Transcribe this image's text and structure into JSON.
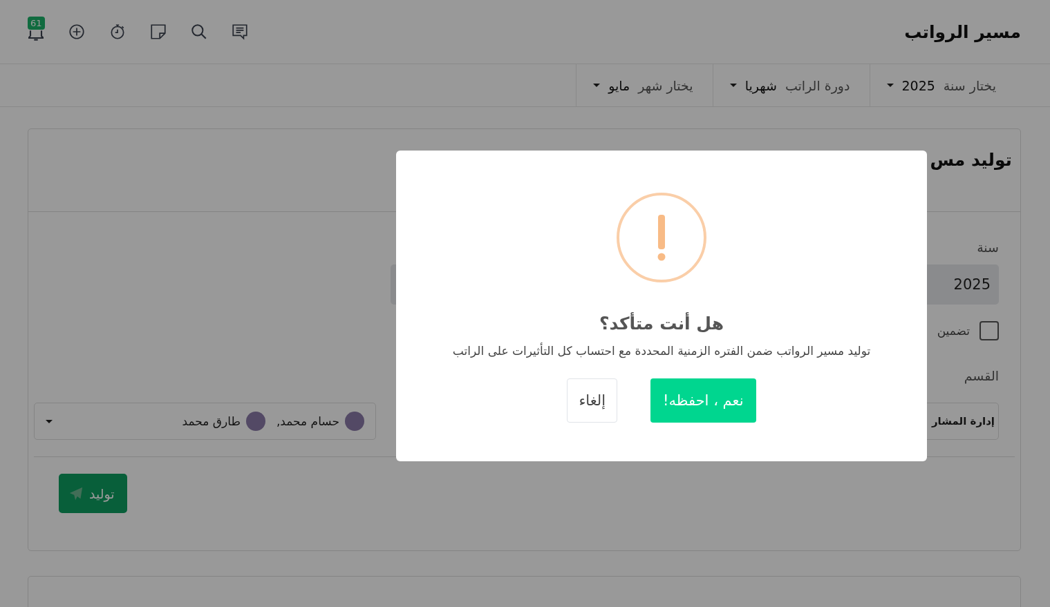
{
  "header": {
    "title": "مسير الرواتب",
    "notification_count": "61"
  },
  "filters": [
    {
      "label": "يختار سنة",
      "value": "2025"
    },
    {
      "label": "دورة الراتب",
      "value": "شهريا"
    },
    {
      "label": "يختار شهر",
      "value": "مايو"
    }
  ],
  "card": {
    "title": "توليد مس",
    "year_label": "سنة",
    "year_value": "2025",
    "checkbox": {
      "label": "تضمين",
      "checked": false
    },
    "department_label": "القسم",
    "department_value": "إدارة المشار",
    "employees": [
      "حسام محمد,",
      "طارق محمد"
    ],
    "generate_button": "توليد"
  },
  "dialog": {
    "title": "هل أنت متأكد؟",
    "message": "توليد مسير الرواتب ضمن الفتره الزمنية المحددة مع احتساب كل التأثيرات على الراتب",
    "confirm_button": "نعم ، احفظه!",
    "cancel_button": "إلغاء"
  }
}
